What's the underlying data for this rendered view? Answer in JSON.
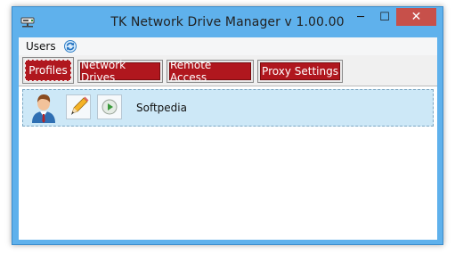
{
  "window": {
    "title": "TK Network Drive Manager v 1.00.00",
    "accent": "#5fb1ec",
    "controls": {
      "minimize": "─",
      "maximize": "☐",
      "close": "✕"
    }
  },
  "menu": {
    "items": [
      {
        "label": "Users"
      }
    ],
    "refresh_icon": "refresh-icon"
  },
  "tabs": [
    {
      "label": "Profiles",
      "active": true
    },
    {
      "label": "Network Drives",
      "active": false
    },
    {
      "label": "Remote Access",
      "active": false
    },
    {
      "label": "Proxy Settings",
      "active": false
    }
  ],
  "tab_color": "#b0171e",
  "profiles": [
    {
      "name": "Softpedia",
      "icon": "user-icon",
      "edit_icon": "pencil-icon",
      "connect_icon": "play-icon"
    }
  ]
}
